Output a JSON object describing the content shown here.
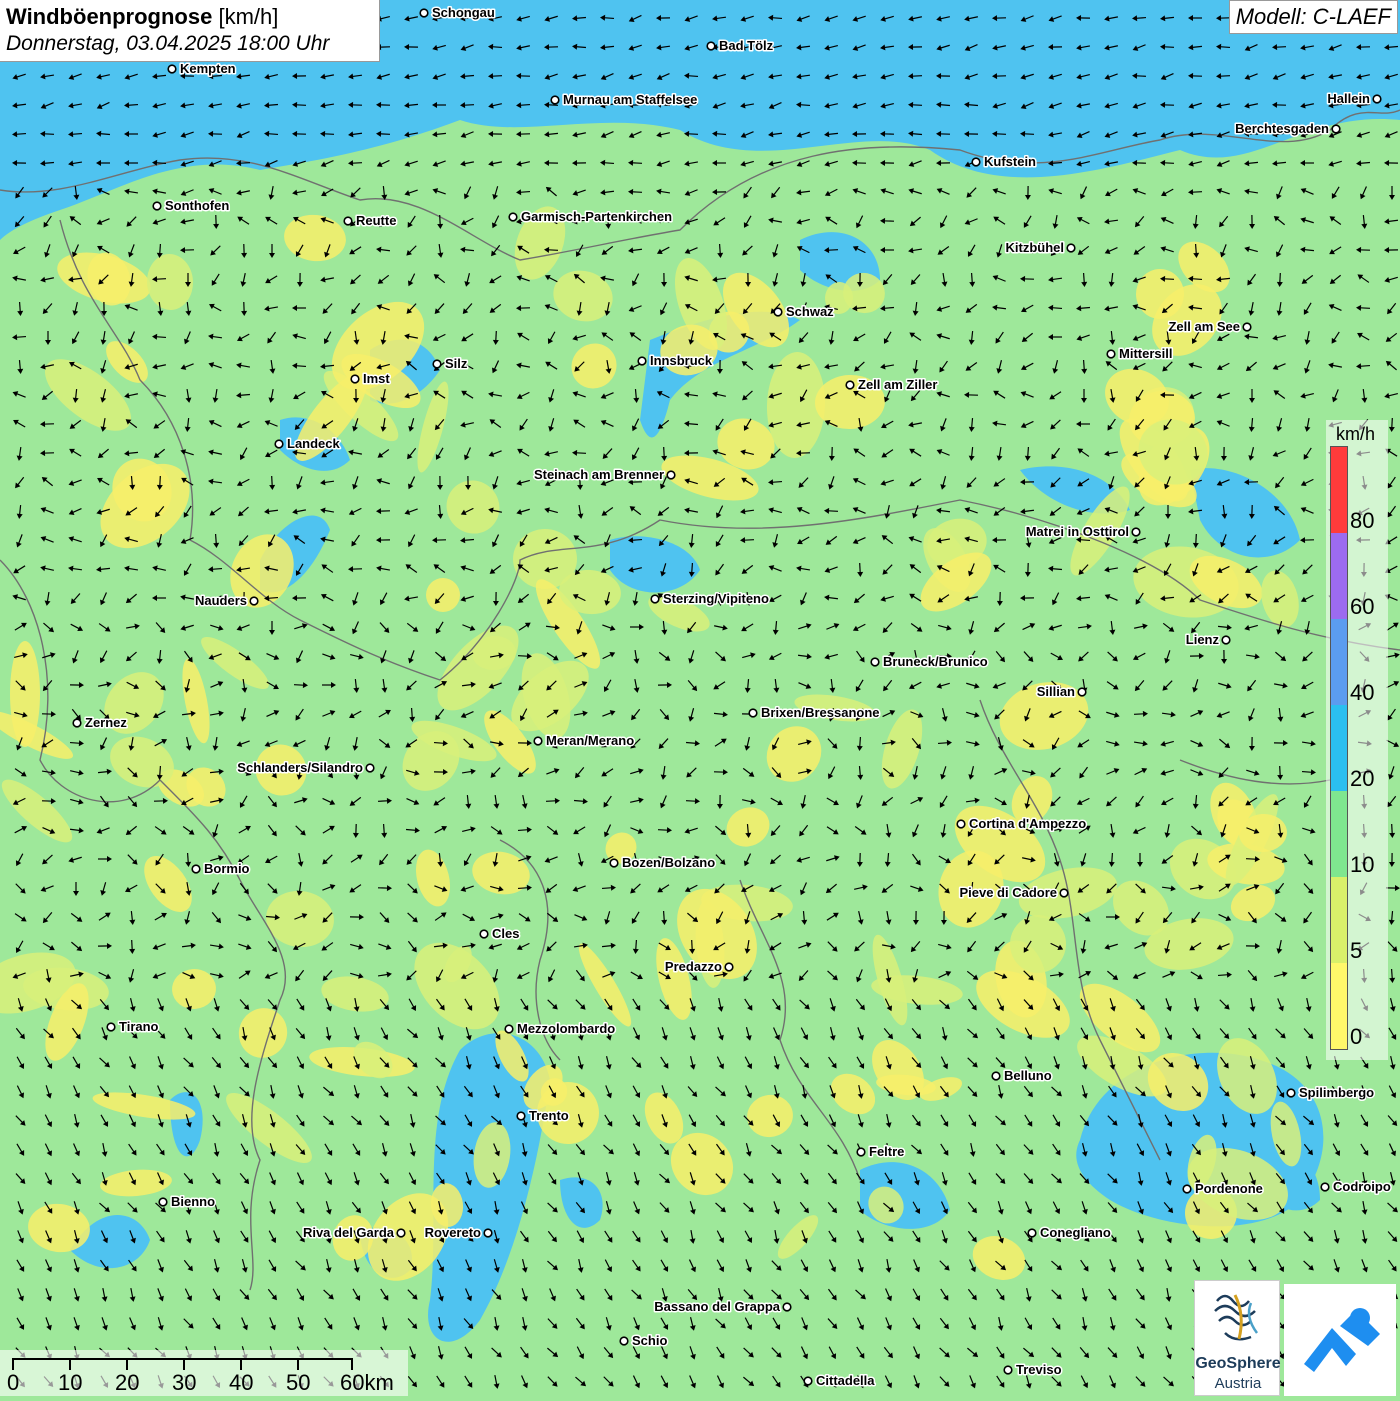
{
  "header": {
    "title_bold": "Windböenprognose",
    "title_unit": " [km/h]",
    "datetime": "Donnerstag, 03.04.2025 18:00 Uhr",
    "model": "Modell: C-LAEF"
  },
  "legend": {
    "unit": "km/h",
    "ticks": [
      "80",
      "60",
      "40",
      "20",
      "10",
      "5",
      "0"
    ],
    "colors": [
      "#ff3b3b",
      "#9c6bf0",
      "#5b9cf0",
      "#2bbff0",
      "#7fe68f",
      "#d9f06a",
      "#fff86a"
    ]
  },
  "scalebar": {
    "labels": [
      "0",
      "10",
      "20",
      "30",
      "40",
      "50",
      "60km"
    ]
  },
  "logos": {
    "geosphere_line1": "GeoSphere",
    "geosphere_line2": "Austria"
  },
  "map": {
    "colors": {
      "calm": "#f7ee6a",
      "light": "#d8f07a",
      "moderate": "#9ee89a",
      "fresh": "#4fc3f0",
      "border": "#707070"
    },
    "cities": [
      {
        "name": "Schongau",
        "label_side": "right"
      },
      {
        "name": "Bad Tölz",
        "label_side": "right"
      },
      {
        "name": "Kempten",
        "label_side": "right"
      },
      {
        "name": "Murnau am Staffelsee",
        "label_side": "right"
      },
      {
        "name": "Hallein",
        "label_side": "left"
      },
      {
        "name": "Berchtesgaden",
        "label_side": "left"
      },
      {
        "name": "Kufstein",
        "label_side": "right"
      },
      {
        "name": "Sonthofen",
        "label_side": "right"
      },
      {
        "name": "Reutte",
        "label_side": "right"
      },
      {
        "name": "Garmisch-Partenkirchen",
        "label_side": "right"
      },
      {
        "name": "Kitzbühel",
        "label_side": "left"
      },
      {
        "name": "Schwaz",
        "label_side": "right"
      },
      {
        "name": "Zell am See",
        "label_side": "left"
      },
      {
        "name": "Innsbruck",
        "label_side": "right"
      },
      {
        "name": "Mittersill",
        "label_side": "right"
      },
      {
        "name": "Imst",
        "label_side": "right"
      },
      {
        "name": "Silz",
        "label_side": "right"
      },
      {
        "name": "Zell am Ziller",
        "label_side": "right"
      },
      {
        "name": "Landeck",
        "label_side": "right"
      },
      {
        "name": "Steinach am Brenner",
        "label_side": "left"
      },
      {
        "name": "Matrei in Osttirol",
        "label_side": "left"
      },
      {
        "name": "Nauders",
        "label_side": "left"
      },
      {
        "name": "Sterzing/Vipiteno",
        "label_side": "right"
      },
      {
        "name": "Lienz",
        "label_side": "left"
      },
      {
        "name": "Bruneck/Brunico",
        "label_side": "right"
      },
      {
        "name": "Sillian",
        "label_side": "left"
      },
      {
        "name": "Brixen/Bressanone",
        "label_side": "right"
      },
      {
        "name": "Zernez",
        "label_side": "right"
      },
      {
        "name": "Meran/Merano",
        "label_side": "right"
      },
      {
        "name": "Schlanders/Silandro",
        "label_side": "left"
      },
      {
        "name": "Cortina d'Ampezzo",
        "label_side": "right"
      },
      {
        "name": "Bormio",
        "label_side": "right"
      },
      {
        "name": "Bozen/Bolzano",
        "label_side": "right"
      },
      {
        "name": "Pieve di Cadore",
        "label_side": "left"
      },
      {
        "name": "Cles",
        "label_side": "right"
      },
      {
        "name": "Predazzo",
        "label_side": "left"
      },
      {
        "name": "Tirano",
        "label_side": "right"
      },
      {
        "name": "Mezzolombardo",
        "label_side": "right"
      },
      {
        "name": "Belluno",
        "label_side": "right"
      },
      {
        "name": "Spilimbergo",
        "label_side": "right"
      },
      {
        "name": "Trento",
        "label_side": "right"
      },
      {
        "name": "Feltre",
        "label_side": "right"
      },
      {
        "name": "Bienno",
        "label_side": "right"
      },
      {
        "name": "Pordenone",
        "label_side": "right"
      },
      {
        "name": "Codroipo",
        "label_side": "right"
      },
      {
        "name": "Riva del Garda",
        "label_side": "left"
      },
      {
        "name": "Rovereto",
        "label_side": "left"
      },
      {
        "name": "Conegliano",
        "label_side": "right"
      },
      {
        "name": "Bassano del Grappa",
        "label_side": "left"
      },
      {
        "name": "Schio",
        "label_side": "right"
      },
      {
        "name": "Treviso",
        "label_side": "right"
      },
      {
        "name": "Cittadella",
        "label_side": "right"
      }
    ]
  }
}
